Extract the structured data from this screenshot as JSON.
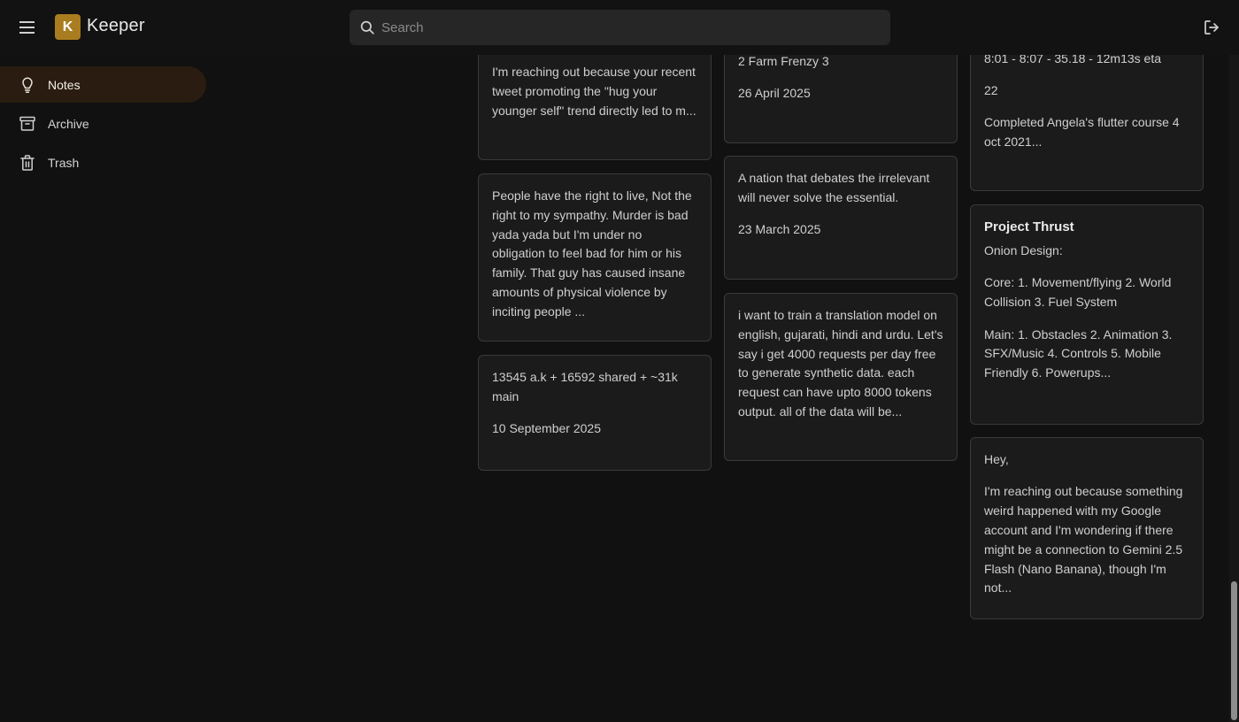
{
  "header": {
    "app_name": "Keeper",
    "logo_letter": "K",
    "search_placeholder": "Search",
    "accent_color": "#a97d1f"
  },
  "sidebar": {
    "items": [
      {
        "label": "Notes",
        "icon": "lightbulb-icon",
        "active": true
      },
      {
        "label": "Archive",
        "icon": "archive-box-icon",
        "active": false
      },
      {
        "label": "Trash",
        "icon": "trash-icon",
        "active": false
      }
    ]
  },
  "notes": {
    "col1": [
      {
        "lines": [
          "I'm reaching out because your recent tweet promoting the \"hug your younger self\" trend directly led to m..."
        ]
      },
      {
        "lines": [
          "People have the right to live, Not the right to my sympathy. Murder is bad yada yada but I'm under no obligation to feel bad for him or his family. That guy has caused insane amounts of physical violence by inciting people ..."
        ]
      },
      {
        "lines": [
          "13545 a.k + 16592 shared + ~31k main",
          "10 September 2025"
        ]
      }
    ],
    "col2": [
      {
        "lines": [
          "2 Farm Frenzy 3",
          "26 April 2025"
        ]
      },
      {
        "lines": [
          "A nation that debates the irrelevant will never solve the essential.",
          "23 March 2025"
        ]
      },
      {
        "lines": [
          "i want to train a translation model on english, gujarati, hindi and urdu. Let's say i get 4000 requests per day free to generate synthetic data. each request can have upto 8000 tokens output. all of the data will be..."
        ]
      }
    ],
    "col3": [
      {
        "lines": [
          "8:01 - 8:07 - 35.18 - 12m13s eta",
          "22",
          "Completed Angela's flutter course 4 oct 2021..."
        ]
      },
      {
        "title": "Project Thrust",
        "lines": [
          "Onion Design:",
          "Core: 1. Movement/flying 2. World Collision 3. Fuel System",
          "Main: 1. Obstacles 2. Animation 3. SFX/Music 4. Controls 5. Mobile Friendly 6. Powerups..."
        ]
      },
      {
        "lines": [
          "Hey,",
          "I'm reaching out because something weird happened with my Google account and I'm wondering if there might be a connection to Gemini 2.5 Flash (Nano Banana), though I'm not..."
        ]
      }
    ]
  }
}
